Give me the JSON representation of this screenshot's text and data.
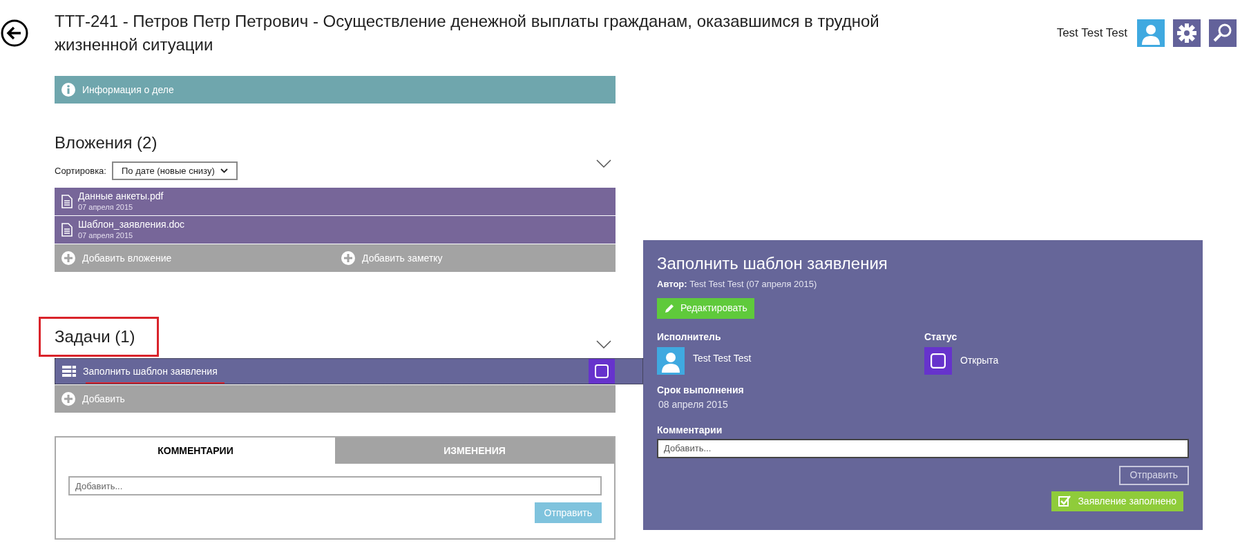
{
  "header": {
    "title": "ТТТ-241 -  Петров Петр  Петрович - Осуществление денежной выплаты гражданам, оказавшимся в трудной жизненной ситуации",
    "user_name": "Test Test Test"
  },
  "info_bar": {
    "label": "Информация о деле"
  },
  "attachments": {
    "heading": "Вложения (2)",
    "sort_label": "Сортировка:",
    "sort_value": "По дате (новые снизу)",
    "files": [
      {
        "name": "Данные анкеты.pdf",
        "date": "07 апреля 2015"
      },
      {
        "name": "Шаблон_заявления.doc",
        "date": "07 апреля 2015"
      }
    ],
    "actions": [
      "Добавить вложение",
      "Добавить заметку"
    ]
  },
  "tasks": {
    "heading": "Задачи (1)",
    "items": [
      {
        "title": "Заполнить шаблон заявления",
        "selected": true,
        "checked": false
      }
    ],
    "add_label": "Добавить"
  },
  "comments": {
    "tabs": [
      {
        "label": "КОММЕНТАРИИ",
        "selected": true
      },
      {
        "label": "ИЗМЕНЕНИЯ",
        "selected": false
      }
    ],
    "placeholder": "Добавить...",
    "send": "Отправить"
  },
  "task_panel": {
    "title": "Заполнить шаблон заявления",
    "author_label": "Автор:",
    "author": "Test Test Test (07 апреля 2015)",
    "edit_button": "Редактировать",
    "assignee_label": "Исполнитель",
    "assignee": "Test Test Test",
    "status_label": "Статус",
    "status": "Открыта",
    "status_checked": false,
    "due_label": "Срок выполнения",
    "due": "08 апреля 2015",
    "comments_label": "Комментарии",
    "comment_placeholder": "Добавить...",
    "send": "Отправить",
    "complete_button": "Заявление заполнено"
  }
}
